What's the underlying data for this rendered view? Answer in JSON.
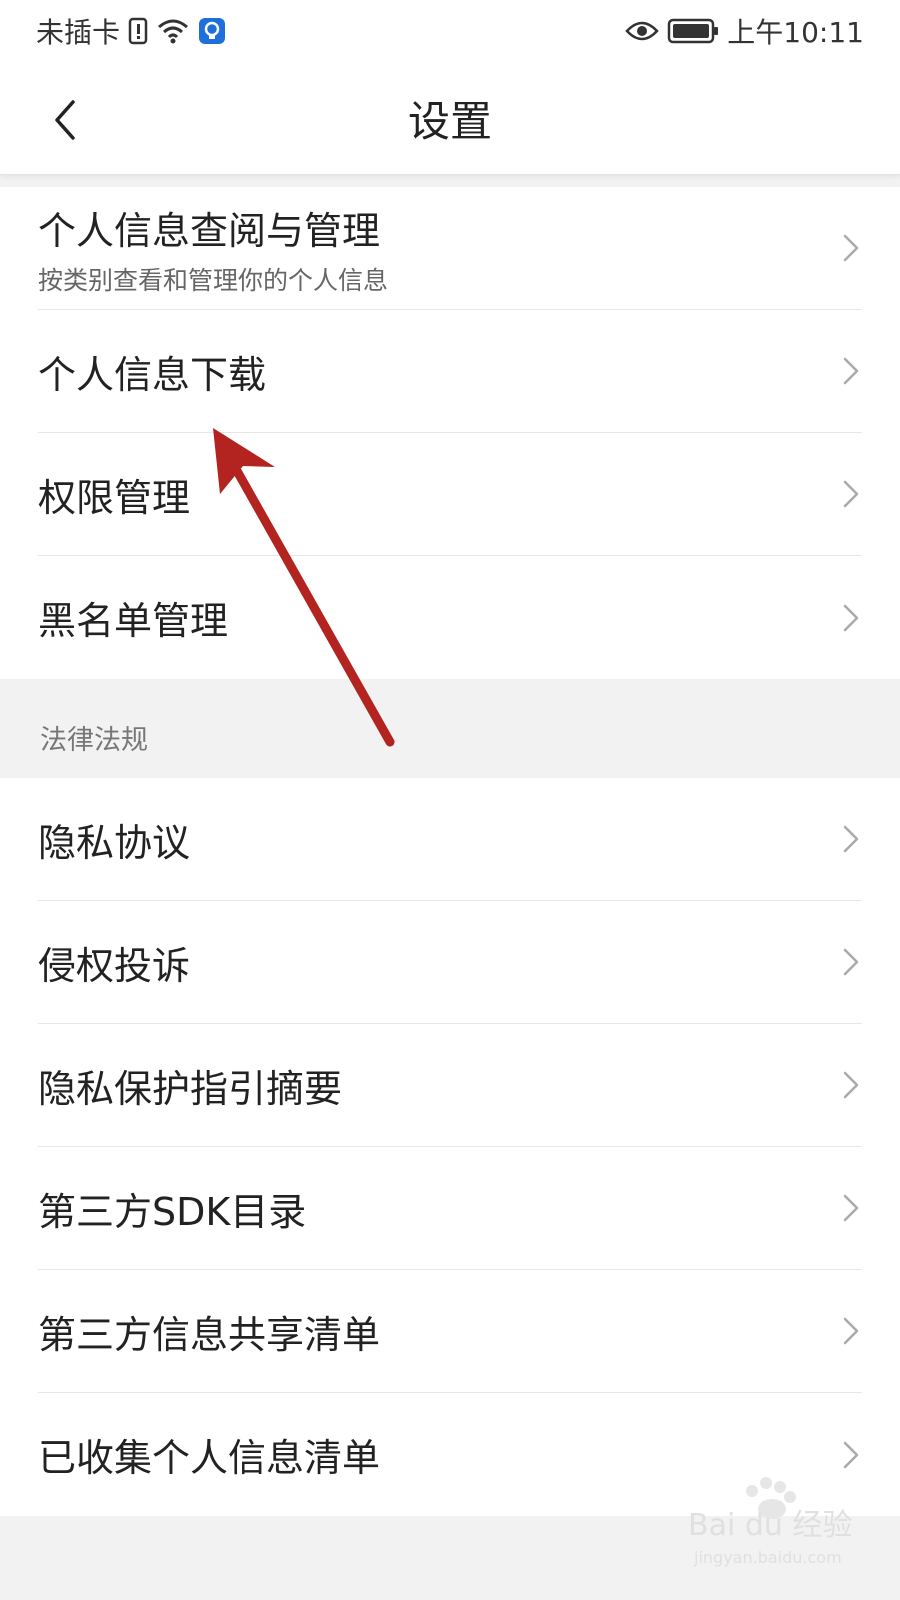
{
  "status_bar": {
    "carrier": "未插卡",
    "time": "上午10:11",
    "icons": [
      "sim-alert-icon",
      "wifi-icon",
      "bulb-icon",
      "eye-icon",
      "battery-icon"
    ]
  },
  "header": {
    "title": "设置",
    "back_icon": "chevron-left-icon"
  },
  "sections": [
    {
      "items": [
        {
          "label": "个人信息查阅与管理",
          "subtitle": "按类别查看和管理你的个人信息"
        },
        {
          "label": "个人信息下载"
        },
        {
          "label": "权限管理"
        },
        {
          "label": "黑名单管理"
        }
      ]
    },
    {
      "title": "法律法规",
      "items": [
        {
          "label": "隐私协议"
        },
        {
          "label": "侵权投诉"
        },
        {
          "label": "隐私保护指引摘要"
        },
        {
          "label": "第三方SDK目录"
        },
        {
          "label": "第三方信息共享清单"
        },
        {
          "label": "已收集个人信息清单"
        }
      ]
    }
  ],
  "watermark": {
    "text": "Bai du 经验",
    "sub": "jingyan.baidu.com"
  },
  "colors": {
    "arrow": "#b3231f",
    "accent_bulb": "#1e6fd9"
  }
}
